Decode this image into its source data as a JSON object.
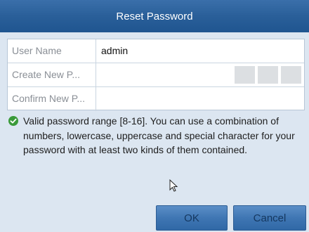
{
  "dialog": {
    "title": "Reset Password"
  },
  "form": {
    "fields": [
      {
        "label": "User Name",
        "value": "admin"
      },
      {
        "label": "Create New P...",
        "value": ""
      },
      {
        "label": "Confirm New P...",
        "value": ""
      }
    ],
    "strength_segments": 3
  },
  "info": {
    "icon": "check-circle-icon",
    "text": "Valid password range [8-16]. You can use a combination of numbers, lowercase, uppercase and special character for your password with at least two kinds of them contained."
  },
  "buttons": {
    "ok_label": "OK",
    "cancel_label": "Cancel"
  },
  "colors": {
    "title_bar": "#2a5f99",
    "dialog_bg": "#dce6f1",
    "button": "#3f76b3",
    "check": "#3a9a3a"
  }
}
